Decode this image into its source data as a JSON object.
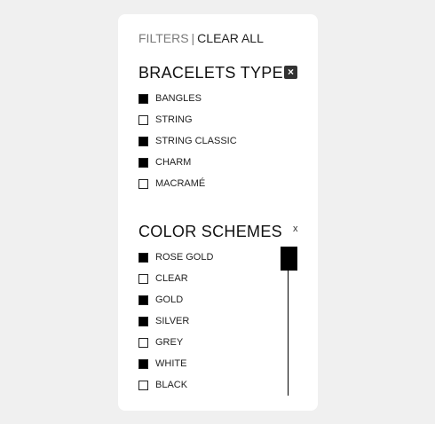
{
  "header": {
    "filters_label": "FILTERS",
    "separator": "|",
    "clear_all_label": "CLEAR ALL"
  },
  "bracelets": {
    "title": "BRACELETS TYPE",
    "close_icon": "×",
    "options": [
      {
        "label": "BANGLES",
        "checked": true
      },
      {
        "label": "STRING",
        "checked": false
      },
      {
        "label": "STRING CLASSIC",
        "checked": true
      },
      {
        "label": "CHARM",
        "checked": true
      },
      {
        "label": "MACRAMÉ",
        "checked": false
      }
    ]
  },
  "colors": {
    "title": "COLOR SCHEMES",
    "close_icon": "x",
    "options": [
      {
        "label": "ROSE GOLD",
        "checked": true
      },
      {
        "label": "CLEAR",
        "checked": false
      },
      {
        "label": "GOLD",
        "checked": true
      },
      {
        "label": "SILVER",
        "checked": true
      },
      {
        "label": "GREY",
        "checked": false
      },
      {
        "label": "WHITE",
        "checked": true
      },
      {
        "label": "BLACK",
        "checked": false
      }
    ]
  },
  "style": {
    "page_background": "#f0f0f0",
    "panel_background": "#ffffff",
    "checked_color": "#000000"
  }
}
